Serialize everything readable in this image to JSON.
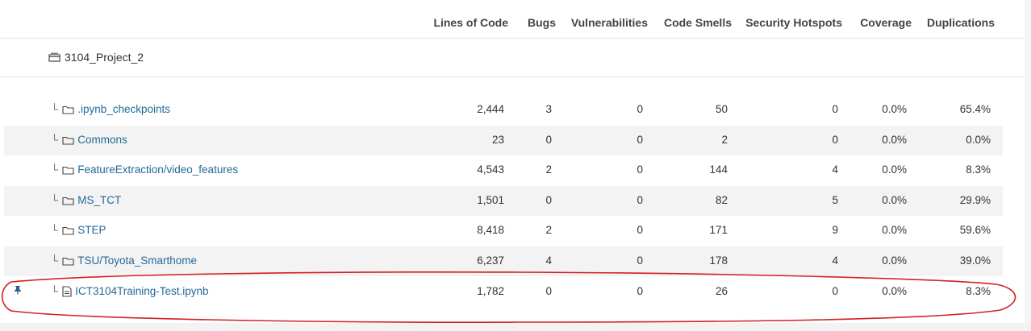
{
  "columns": {
    "lines_of_code": "Lines of Code",
    "bugs": "Bugs",
    "vulnerabilities": "Vulnerabilities",
    "code_smells": "Code Smells",
    "security_hotspots": "Security Hotspots",
    "coverage": "Coverage",
    "duplications": "Duplications"
  },
  "project": {
    "name": "3104_Project_2",
    "icon": "project-icon"
  },
  "tree_glyph": "└",
  "rows": [
    {
      "name": ".ipynb_checkpoints",
      "type": "folder",
      "loc": "2,444",
      "bugs": "3",
      "vulnerabilities": "0",
      "code_smells": "50",
      "security_hotspots": "0",
      "coverage": "0.0%",
      "duplications": "65.4%"
    },
    {
      "name": "Commons",
      "type": "folder",
      "loc": "23",
      "bugs": "0",
      "vulnerabilities": "0",
      "code_smells": "2",
      "security_hotspots": "0",
      "coverage": "0.0%",
      "duplications": "0.0%"
    },
    {
      "name": "FeatureExtraction/video_features",
      "type": "folder",
      "loc": "4,543",
      "bugs": "2",
      "vulnerabilities": "0",
      "code_smells": "144",
      "security_hotspots": "4",
      "coverage": "0.0%",
      "duplications": "8.3%"
    },
    {
      "name": "MS_TCT",
      "type": "folder",
      "loc": "1,501",
      "bugs": "0",
      "vulnerabilities": "0",
      "code_smells": "82",
      "security_hotspots": "5",
      "coverage": "0.0%",
      "duplications": "29.9%"
    },
    {
      "name": "STEP",
      "type": "folder",
      "loc": "8,418",
      "bugs": "2",
      "vulnerabilities": "0",
      "code_smells": "171",
      "security_hotspots": "9",
      "coverage": "0.0%",
      "duplications": "59.6%"
    },
    {
      "name": "TSU/Toyota_Smarthome",
      "type": "folder",
      "loc": "6,237",
      "bugs": "4",
      "vulnerabilities": "0",
      "code_smells": "178",
      "security_hotspots": "4",
      "coverage": "0.0%",
      "duplications": "39.0%"
    },
    {
      "name": "ICT3104Training-Test.ipynb",
      "type": "file",
      "pinned": true,
      "loc": "1,782",
      "bugs": "0",
      "vulnerabilities": "0",
      "code_smells": "26",
      "security_hotspots": "0",
      "coverage": "0.0%",
      "duplications": "8.3%"
    }
  ],
  "colors": {
    "link": "#236a97",
    "row_alt": "#f3f3f3",
    "annotation": "#d42020",
    "pin": "#2a5f8c"
  }
}
